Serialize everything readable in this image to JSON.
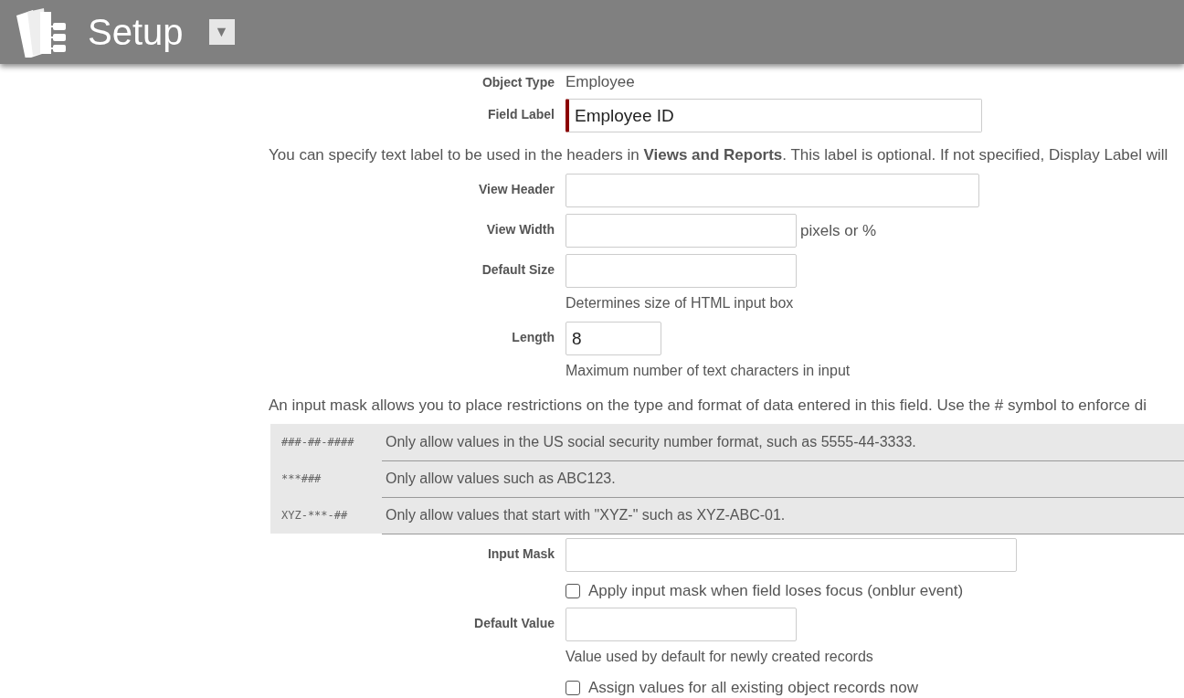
{
  "header": {
    "title": "Setup",
    "menu_button": "▼"
  },
  "rows": [
    {
      "kind": "static",
      "label": "Object Type",
      "value": "Employee"
    },
    {
      "kind": "field",
      "label": "Field Label",
      "value": "Employee ID",
      "required": true
    },
    {
      "kind": "note",
      "text": "You can specify text label to be used in the headers in **Views and Reports**. This label is optional. If not specified, Display Label will"
    },
    {
      "kind": "field",
      "label": "View Header",
      "value": "",
      "required": false
    },
    {
      "kind": "field",
      "label": "View Width",
      "value": "",
      "required": false,
      "suffix": "pixels or %"
    },
    {
      "kind": "field",
      "label": "Default Size",
      "value": "",
      "required": false,
      "hint": "Determines size of HTML input box"
    },
    {
      "kind": "field",
      "label": "Length",
      "value": "8",
      "required": false,
      "hint": "Maximum number of text characters in input"
    },
    {
      "kind": "note",
      "text": "An input mask allows you to place restrictions on the type and format of data entered in this field. Use the # symbol to enforce di"
    },
    {
      "kind": "masks",
      "items": [
        {
          "mask": "###-##-####",
          "description": "Only allow values in the US social security number format, such as 5555-44-3333."
        },
        {
          "mask": "***###",
          "description": "Only allow values such as ABC123."
        },
        {
          "mask": "XYZ-***-##",
          "description": "Only allow values that start with \"XYZ-\" such as XYZ-ABC-01."
        }
      ]
    },
    {
      "kind": "field",
      "label": "Input Mask",
      "value": "",
      "required": false
    },
    {
      "kind": "checkbox",
      "label": "Apply input mask when field loses focus (onblur event)",
      "checked": false
    },
    {
      "kind": "field",
      "label": "Default Value",
      "value": "",
      "required": false,
      "hint": "Value used by default for newly created records"
    },
    {
      "kind": "checkbox",
      "label": "Assign values for all existing object records now",
      "checked": false
    }
  ]
}
